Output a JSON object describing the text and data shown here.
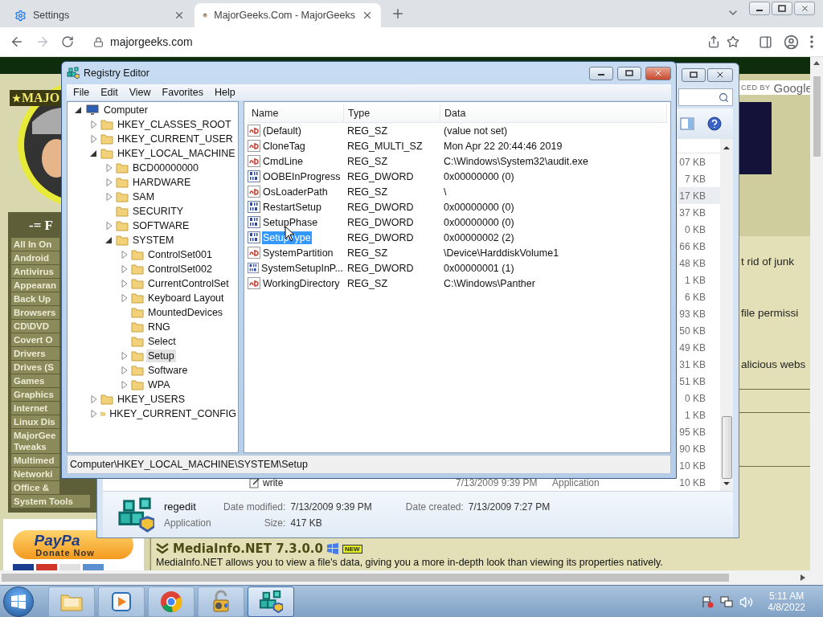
{
  "browser": {
    "tabs": [
      {
        "kind": "settings",
        "label": "Settings",
        "selected": false
      },
      {
        "kind": "site",
        "label": "MajorGeeks.Com - MajorGeeks",
        "selected": true
      }
    ],
    "address": "majorgeeks.com"
  },
  "web_page": {
    "logo_text": "MAJO",
    "sidebar_title": "-= F",
    "categories": [
      "All In On",
      "Android",
      "Antivirus",
      "Appearan",
      "Back Up",
      "Browsers",
      "CD\\DVD",
      "Covert O",
      "Drivers",
      "Drives (S",
      "Games",
      "Graphics",
      "Internet",
      "Linux Dis",
      "MajorGee Tweaks",
      "Multimed",
      "Networki",
      "Office &",
      "System Tools"
    ],
    "paypal": {
      "logo": "PayPa",
      "caption": "Donate Now"
    },
    "search_brand": {
      "prefix": "CED BY",
      "brand": "Google"
    },
    "snippets": [
      "t rid of junk",
      "file permissi",
      "alicious webs"
    ],
    "article": {
      "title": "MediaInfo.NET 7.3.0.0",
      "badge": "NEW",
      "description": "MediaInfo.NET allows you to view a file's data, giving you a more in-depth look than viewing its properties natively."
    }
  },
  "explorer": {
    "files": [
      {
        "size": "07 KB",
        "selected": false
      },
      {
        "size": "7 KB",
        "selected": false
      },
      {
        "size": "17 KB",
        "selected": true
      },
      {
        "size": "37 KB",
        "selected": false
      },
      {
        "size": "0 KB",
        "selected": false
      },
      {
        "size": "66 KB",
        "selected": false
      },
      {
        "size": "48 KB",
        "selected": false
      },
      {
        "size": "1 KB",
        "selected": false
      },
      {
        "size": "6 KB",
        "selected": false
      },
      {
        "size": "93 KB",
        "selected": false
      },
      {
        "size": "50 KB",
        "selected": false
      },
      {
        "size": "49 KB",
        "selected": false
      },
      {
        "size": "31 KB",
        "selected": false
      },
      {
        "size": "51 KB",
        "selected": false
      },
      {
        "size": "0 KB",
        "selected": false
      },
      {
        "size": "1 KB",
        "selected": false
      },
      {
        "size": "95 KB",
        "selected": false
      },
      {
        "size": "90 KB",
        "selected": false
      },
      {
        "size": "10 KB",
        "selected": false
      },
      {
        "name": "write",
        "modified": "7/13/2009 9:39 PM",
        "type": "Application",
        "size": "10 KB",
        "selected": false
      }
    ],
    "details": {
      "name": "regedit",
      "type": "Application",
      "modified_label": "Date modified:",
      "modified": "7/13/2009 9:39 PM",
      "created_label": "Date created:",
      "created": "7/13/2009 7:27 PM",
      "size_label": "Size:",
      "size": "417 KB"
    }
  },
  "registry_editor": {
    "title": "Registry Editor",
    "menu": [
      "File",
      "Edit",
      "View",
      "Favorites",
      "Help"
    ],
    "tree": [
      {
        "label": "Computer",
        "expandable": true,
        "expanded": true,
        "selected": false,
        "children": [
          {
            "label": "HKEY_CLASSES_ROOT",
            "expandable": true,
            "expanded": false,
            "selected": false
          },
          {
            "label": "HKEY_CURRENT_USER",
            "expandable": true,
            "expanded": false,
            "selected": false
          },
          {
            "label": "HKEY_LOCAL_MACHINE",
            "expandable": true,
            "expanded": true,
            "selected": false,
            "children": [
              {
                "label": "BCD00000000",
                "expandable": true,
                "expanded": false,
                "selected": false
              },
              {
                "label": "HARDWARE",
                "expandable": true,
                "expanded": false,
                "selected": false
              },
              {
                "label": "SAM",
                "expandable": true,
                "expanded": false,
                "selected": false
              },
              {
                "label": "SECURITY",
                "expandable": false,
                "expanded": false,
                "selected": false
              },
              {
                "label": "SOFTWARE",
                "expandable": true,
                "expanded": false,
                "selected": false
              },
              {
                "label": "SYSTEM",
                "expandable": true,
                "expanded": true,
                "selected": false,
                "children": [
                  {
                    "label": "ControlSet001",
                    "expandable": true,
                    "expanded": false,
                    "selected": false
                  },
                  {
                    "label": "ControlSet002",
                    "expandable": true,
                    "expanded": false,
                    "selected": false
                  },
                  {
                    "label": "CurrentControlSet",
                    "expandable": true,
                    "expanded": false,
                    "selected": false
                  },
                  {
                    "label": "Keyboard Layout",
                    "expandable": true,
                    "expanded": false,
                    "selected": false
                  },
                  {
                    "label": "MountedDevices",
                    "expandable": false,
                    "expanded": false,
                    "selected": false
                  },
                  {
                    "label": "RNG",
                    "expandable": false,
                    "expanded": false,
                    "selected": false
                  },
                  {
                    "label": "Select",
                    "expandable": false,
                    "expanded": false,
                    "selected": false
                  },
                  {
                    "label": "Setup",
                    "expandable": true,
                    "expanded": false,
                    "selected": true
                  },
                  {
                    "label": "Software",
                    "expandable": true,
                    "expanded": false,
                    "selected": false
                  },
                  {
                    "label": "WPA",
                    "expandable": true,
                    "expanded": false,
                    "selected": false
                  }
                ]
              }
            ]
          },
          {
            "label": "HKEY_USERS",
            "expandable": true,
            "expanded": false,
            "selected": false
          },
          {
            "label": "HKEY_CURRENT_CONFIG",
            "expandable": true,
            "expanded": false,
            "selected": false
          }
        ]
      }
    ],
    "columns": [
      "Name",
      "Type",
      "Data"
    ],
    "values": [
      {
        "kind": "string",
        "name": "(Default)",
        "type": "REG_SZ",
        "data": "(value not set)",
        "selected": false
      },
      {
        "kind": "string",
        "name": "CloneTag",
        "type": "REG_MULTI_SZ",
        "data": "Mon Apr 22 20:44:46 2019",
        "selected": false
      },
      {
        "kind": "string",
        "name": "CmdLine",
        "type": "REG_SZ",
        "data": "C:\\Windows\\System32\\audit.exe",
        "selected": false
      },
      {
        "kind": "dword",
        "name": "OOBEInProgress",
        "type": "REG_DWORD",
        "data": "0x00000000 (0)",
        "selected": false
      },
      {
        "kind": "string",
        "name": "OsLoaderPath",
        "type": "REG_SZ",
        "data": "\\",
        "selected": false
      },
      {
        "kind": "dword",
        "name": "RestartSetup",
        "type": "REG_DWORD",
        "data": "0x00000000 (0)",
        "selected": false
      },
      {
        "kind": "dword",
        "name": "SetupPhase",
        "type": "REG_DWORD",
        "data": "0x00000000 (0)",
        "selected": false
      },
      {
        "kind": "dword",
        "name": "SetupType",
        "type": "REG_DWORD",
        "data": "0x00000002 (2)",
        "selected": true
      },
      {
        "kind": "string",
        "name": "SystemPartition",
        "type": "REG_SZ",
        "data": "\\Device\\HarddiskVolume1",
        "selected": false
      },
      {
        "kind": "dword",
        "name": "SystemSetupInP...",
        "type": "REG_DWORD",
        "data": "0x00000001 (1)",
        "selected": false
      },
      {
        "kind": "string",
        "name": "WorkingDirectory",
        "type": "REG_SZ",
        "data": "C:\\Windows\\Panther",
        "selected": false
      }
    ],
    "status_path": "Computer\\HKEY_LOCAL_MACHINE\\SYSTEM\\Setup"
  },
  "taskbar": {
    "apps": [
      {
        "kind": "explorer",
        "active": false
      },
      {
        "kind": "media",
        "active": false
      },
      {
        "kind": "chrome",
        "active": false
      },
      {
        "kind": "security",
        "active": false
      },
      {
        "kind": "regedit",
        "active": true
      }
    ],
    "clock": {
      "time": "5:11 AM",
      "date": "4/8/2022"
    }
  }
}
